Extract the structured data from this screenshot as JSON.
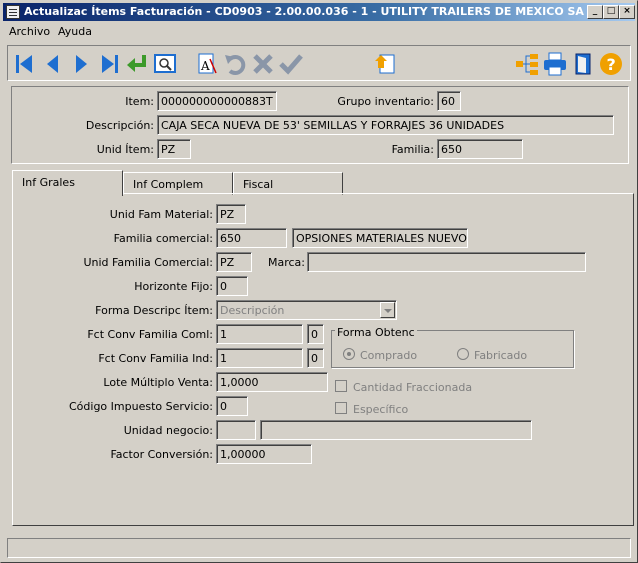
{
  "window": {
    "title": "Actualizac Ítems Facturación - CD0903 - 2.00.00.036 - 1 - UTILITY TRAILERS DE MEXICO SA DE CV",
    "minimize": "_",
    "maximize": "□",
    "close": "×"
  },
  "menu": {
    "archivo": "Archivo",
    "ayuda": "Ayuda"
  },
  "toolbar": {
    "icons": [
      "first-icon",
      "prev-icon",
      "next-icon",
      "last-icon",
      "enter-icon",
      "preview-icon",
      "font-icon",
      "undo-icon",
      "delete-icon",
      "confirm-icon",
      "export-icon",
      "tree-icon",
      "print-icon",
      "exit-icon",
      "help-icon"
    ],
    "colors": {
      "blue": "#1e6ed0",
      "green": "#3c9a2a",
      "gray": "#8a96a8",
      "orange": "#f0a000"
    }
  },
  "header": {
    "item_label": "Item:",
    "item_value": "000000000000883T",
    "grupo_label": "Grupo inventario:",
    "grupo_value": "60",
    "descripcion_label": "Descripción:",
    "descripcion_value": "CAJA SECA NUEVA DE 53' SEMILLAS Y FORRAJES 36 UNIDADES",
    "unid_item_label": "Unid Ítem:",
    "unid_item_value": "PZ",
    "familia_label": "Familia:",
    "familia_value": "650"
  },
  "tabs": [
    "Inf Grales",
    "Inf Complem",
    "Fiscal"
  ],
  "form": {
    "unid_fam_material_label": "Unid Fam Material:",
    "unid_fam_material_value": "PZ",
    "familia_comercial_label": "Familia comercial:",
    "familia_comercial_value": "650",
    "familia_comercial_desc": "OPSIONES MATERIALES NUEVOS",
    "unid_familia_comercial_label": "Unid Familia Comercial:",
    "unid_familia_comercial_value": "PZ",
    "marca_label": "Marca:",
    "marca_value": "",
    "horizonte_fijo_label": "Horizonte Fijo:",
    "horizonte_fijo_value": "0",
    "forma_descripc_label": "Forma Descripc Ítem:",
    "forma_descripc_value": "Descripción",
    "fct_conv_coml_label": "Fct Conv Familia Coml:",
    "fct_conv_coml_value": "1",
    "fct_conv_coml_small": "0",
    "fct_conv_ind_label": "Fct Conv Familia Ind:",
    "fct_conv_ind_value": "1",
    "fct_conv_ind_small": "0",
    "forma_obtenc_label": "Forma Obtenc",
    "comprado_label": "Comprado",
    "fabricado_label": "Fabricado",
    "lote_multiplo_label": "Lote Múltiplo Venta:",
    "lote_multiplo_value": "1,0000",
    "cantidad_fraccionada_label": "Cantidad Fraccionada",
    "codigo_impuesto_label": "Código Impuesto Servicio:",
    "codigo_impuesto_value": "0",
    "especifico_label": "Específico",
    "unidad_negocio_label": "Unidad negocio:",
    "unidad_negocio_value": "",
    "unidad_negocio_desc": "",
    "factor_conversion_label": "Factor Conversión:",
    "factor_conversion_value": "1,00000"
  },
  "status": {
    "text": ""
  }
}
